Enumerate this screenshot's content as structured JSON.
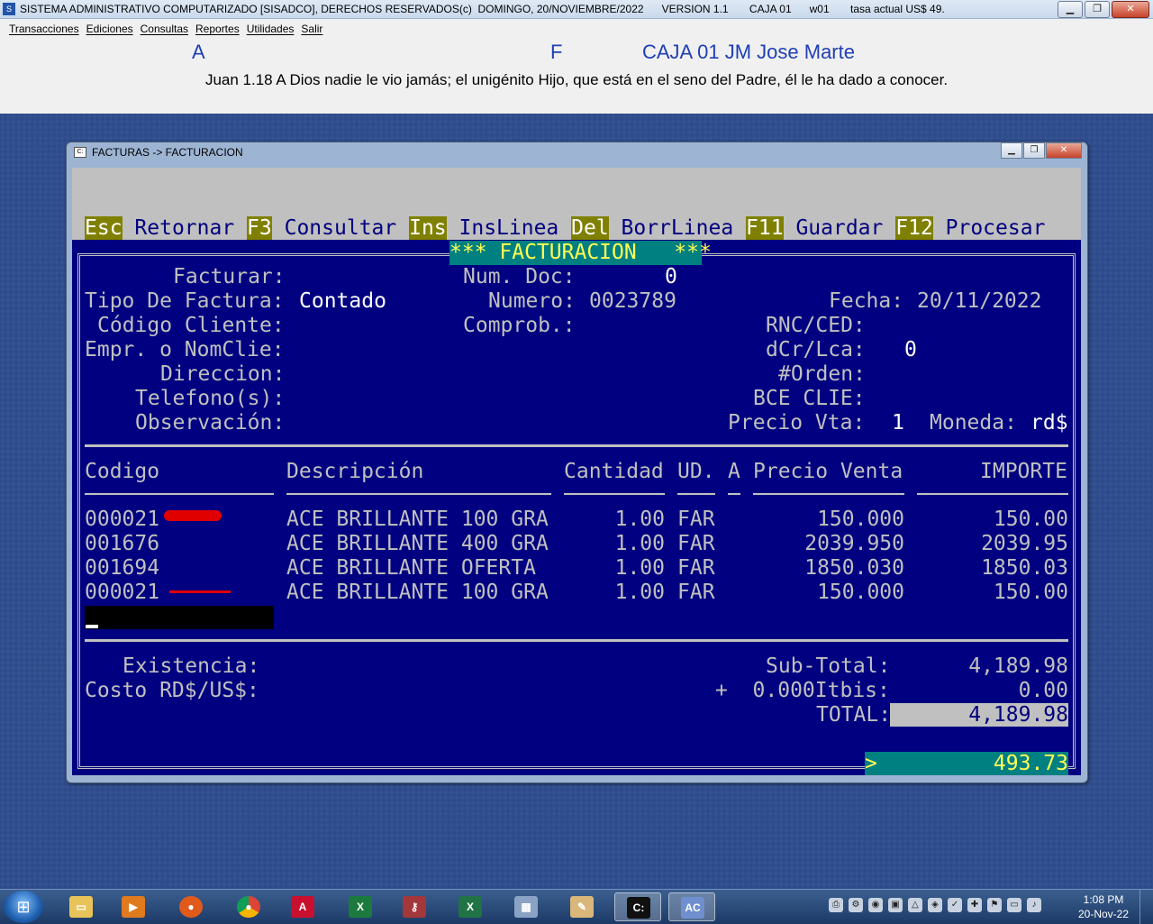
{
  "window": {
    "title": "SISTEMA ADMINISTRATIVO COMPUTARIZADO [SISADCO], DERECHOS RESERVADOS(c)  DOMINGO, 20/NOVIEMBRE/2022      VERSION 1.1       CAJA 01      w01       tasa actual US$ 49."
  },
  "menu": {
    "items": [
      "Transacciones",
      "Ediciones",
      "Consultas",
      "Reportes",
      "Utilidades",
      "Salir"
    ]
  },
  "header": {
    "a": "A",
    "f": "F",
    "caja": "CAJA 01  JM Jose Marte",
    "verse": "Juan 1.18 A Dios nadie le vio jamás; el unigénito Hijo, que está en el seno del Padre, él le ha dado a conocer."
  },
  "sub_window": {
    "title": "FACTURAS -> FACTURACION"
  },
  "hotkeys": [
    {
      "key": "Esc",
      "label": "Retornar"
    },
    {
      "key": "F3",
      "label": "Consultar"
    },
    {
      "key": "Ins",
      "label": "InsLinea"
    },
    {
      "key": "Del",
      "label": "BorrLinea"
    },
    {
      "key": "F11",
      "label": "Guardar"
    },
    {
      "key": "F12",
      "label": "Procesar"
    }
  ],
  "banner": "*** FACTURACION   ***",
  "form": {
    "facturar_label": "Facturar:",
    "tipo_label": "Tipo De Factura:",
    "tipo_value": "Contado",
    "codigo_label": "Código Cliente:",
    "empr_label": "Empr. o NomClie:",
    "direccion_label": "Direccion:",
    "telefono_label": "Telefono(s):",
    "observacion_label": "Observación:",
    "numdoc_label": "Num. Doc:",
    "numdoc_value": "0",
    "numero_label": "Numero:",
    "numero_value": "0023789",
    "comprob_label": "Comprob.:",
    "fecha_label": "Fecha:",
    "fecha_value": "20/11/2022",
    "rnc_label": "RNC/CED:",
    "dcr_label": "dCr/Lca:",
    "dcr_value": "0",
    "orden_label": "#Orden:",
    "bce_label": "BCE CLIE:",
    "precio_vta_label": "Precio Vta:",
    "precio_vta_value": "1",
    "moneda_label": "Moneda:",
    "moneda_value": "rd$"
  },
  "table": {
    "headers": {
      "codigo": "Codigo",
      "descripcion": "Descripción",
      "cantidad": "Cantidad",
      "ud": "UD.",
      "a": "A",
      "precio": "Precio Venta",
      "importe": "IMPORTE"
    },
    "rows": [
      {
        "codigo": "000021",
        "descripcion": "ACE BRILLANTE 100 GRA",
        "cantidad": "1.00",
        "ud": "FAR",
        "precio": "150.000",
        "importe": "150.00"
      },
      {
        "codigo": "001676",
        "descripcion": "ACE BRILLANTE 400 GRA",
        "cantidad": "1.00",
        "ud": "FAR",
        "precio": "2039.950",
        "importe": "2039.95"
      },
      {
        "codigo": "001694",
        "descripcion": "ACE BRILLANTE OFERTA",
        "cantidad": "1.00",
        "ud": "FAR",
        "precio": "1850.030",
        "importe": "1850.03"
      },
      {
        "codigo": "000021",
        "descripcion": "ACE BRILLANTE 100 GRA",
        "cantidad": "1.00",
        "ud": "FAR",
        "precio": "150.000",
        "importe": "150.00"
      }
    ]
  },
  "footer": {
    "existencia_label": "Existencia:",
    "costo_label": "Costo RD$/US$:",
    "subtotal_label": "Sub-Total:",
    "subtotal_value": "4,189.98",
    "itbis_label": "+  0.000Itbis:",
    "itbis_value": "0.00",
    "total_label": "TOTAL:",
    "total_value": "4,189.98",
    "prompt": ">",
    "usd_value": "493.73"
  },
  "taskbar": {
    "time": "1:08 PM",
    "date": "20-Nov-22"
  }
}
